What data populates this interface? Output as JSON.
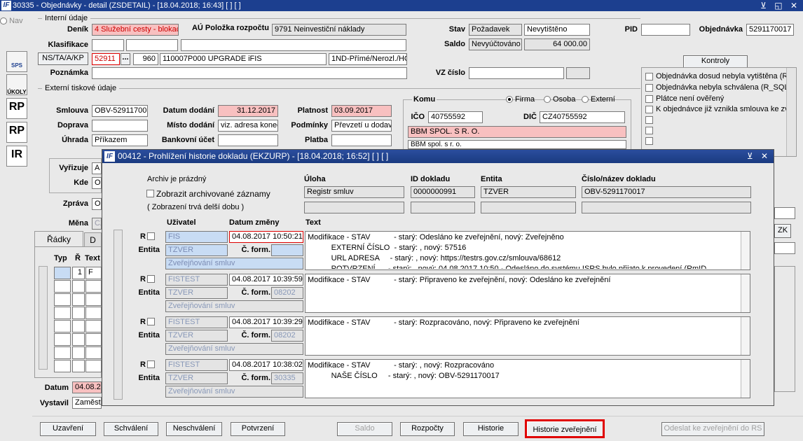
{
  "window": {
    "title": "30335 - Objednávky - detail (ZSDETAIL) - [18.04.2018; 16:43] [ ] [ ]",
    "controls": "⊻ ◱ ✕"
  },
  "side": {
    "nav": "Nav",
    "sps": "SPS",
    "ukoly": "ÚKOLY",
    "rp1": "RP",
    "rp2": "RP",
    "ir": "IR"
  },
  "interni": {
    "section": "Interní údaje",
    "denik_label": "Deník",
    "denik": "4 Služební cesty - blokac",
    "au_label": "AÚ Položka rozpočtu",
    "au": "9791 Neinvestiční náklady",
    "klasifikace_label": "Klasifikace",
    "nstakp_label": "NS/TA/A/KP",
    "ns": "52911",
    "ns_btn": "...",
    "ta": "960",
    "a": "110007P000 UPGRADE iFIS",
    "kp": "1ND-Přímé/Nerozl./HČ-",
    "poznamka_label": "Poznámka",
    "stav_label": "Stav",
    "stav1": "Požadavek",
    "stav2": "Nevytištěno",
    "saldo_label": "Saldo",
    "saldo1": "Nevyúčtováno",
    "saldo2": "64 000.00",
    "vz_label": "VZ číslo",
    "pid_label": "PID",
    "obj_label": "Objednávka",
    "obj": "5291170017"
  },
  "kontroly": {
    "button": "Kontroly",
    "items": [
      "Objednávka dosud nebyla vytištěna (R",
      "Objednávka nebyla schválena (R_SQL",
      "Plátce není ověřený",
      "K objednávce již vznikla smlouva ke zv"
    ]
  },
  "externi": {
    "section": "Externí tiskové údaje",
    "smlouva_label": "Smlouva",
    "smlouva": "OBV-52911700",
    "doprava_label": "Doprava",
    "uhrada_label": "Úhrada",
    "uhrada": "Příkazem",
    "datum_label": "Datum dodání",
    "datum": "31.12.2017",
    "misto_label": "Místo dodání",
    "misto": "viz. adresa konec",
    "bank_label": "Bankovní účet",
    "platnost_label": "Platnost",
    "platnost": "03.09.2017",
    "podminky_label": "Podmínky",
    "podminky": "Převzetí u dodav",
    "platba_label": "Platba",
    "vyrizuje_label": "Vyřizuje",
    "vyrizuje": "A",
    "kde_label": "Kde",
    "kde": "O",
    "zprava_label": "Zpráva",
    "zprava": "O",
    "mena_label": "Měna",
    "mena": "CZ"
  },
  "komu": {
    "title": "Komu",
    "firma": "Firma",
    "osoba": "Osoba",
    "externi": "Externí",
    "ico_label": "IČO",
    "ico": "40755592",
    "dic_label": "DIČ",
    "dic": "CZ40755592",
    "name": "BBM SPOL. S R. O.",
    "name2": "BBM spol. s r. o."
  },
  "radky": {
    "tab1": "Řádky",
    "tab2": "D",
    "typ": "Typ",
    "r": "Ř",
    "text": "Text",
    "row1_r": "1",
    "row1_t": "F",
    "datum_label": "Datum",
    "datum": "04.08.2",
    "vystavil_label": "Vystavil",
    "vystavil": "Zaměst",
    "zk": "ZK"
  },
  "modal": {
    "title": "00412 - Prohlížení historie dokladu (EKZURP) - [18.04.2018; 16:52] [ ] [ ]",
    "controls": "⊻ ✕",
    "archiv": "Archiv je prázdný",
    "zobrazit": "Zobrazit archivované záznamy",
    "zobrazeni": "( Zobrazení trvá delší dobu )",
    "uloha_label": "Úloha",
    "uloha": "Registr smluv",
    "id_label": "ID dokladu",
    "id": "0000000991",
    "entita_label": "Entita",
    "entita": "TZVER",
    "cislo_label": "Číslo/název dokladu",
    "cislo": "OBV-5291170017",
    "uzivatel_label": "Uživatel",
    "datumzm_label": "Datum změny",
    "text_label": "Text",
    "r_label": "R",
    "entita_row_label": "Entita",
    "cform_label": "Č. form.",
    "records": [
      {
        "user": "FIS",
        "date": "04.08.2017 10:50:21",
        "entity": "TZVER",
        "form": "",
        "desc": "Zveřejňování smluv",
        "lines": [
          "Modifikace - STAV           - starý: Odesláno ke zveřejnění, nový: Zveřejněno",
          "           EXTERNÍ ČÍSLO  - starý: , nový: 57516",
          "           URL ADRESA     - starý: , nový: https://testrs.gov.cz/smlouva/68612",
          "           POTVRZENÍ      - starý: , nový: 04.08.2017 10:50 - Odesláno do systému ISRS bylo přijato k provedení (RmID"
        ]
      },
      {
        "user": "FISTEST",
        "date": "04.08.2017 10:39:59",
        "entity": "TZVER",
        "form": "08202",
        "desc": "Zveřejňování smluv",
        "lines": [
          "Modifikace - STAV           - starý: Připraveno ke zveřejnění, nový: Odesláno ke zveřejnění"
        ]
      },
      {
        "user": "FISTEST",
        "date": "04.08.2017 10:39:29",
        "entity": "TZVER",
        "form": "08202",
        "desc": "Zveřejňování smluv",
        "lines": [
          "Modifikace - STAV           - starý: Rozpracováno, nový: Připraveno ke zveřejnění"
        ]
      },
      {
        "user": "FISTEST",
        "date": "04.08.2017 10:38:02",
        "entity": "TZVER",
        "form": "30335",
        "desc": "Zveřejňování smluv",
        "lines": [
          "Modifikace - STAV           - starý: , nový: Rozpracováno",
          "           NAŠE ČÍSLO     - starý: , nový: OBV-5291170017"
        ]
      }
    ]
  },
  "buttons": {
    "uzavreni": "Uzavření",
    "schvaleni": "Schválení",
    "neschvaleni": "Neschválení",
    "potvrzeni": "Potvrzení",
    "saldo": "Saldo",
    "rozpocty": "Rozpočty",
    "historie": "Historie",
    "historie_zver": "Historie zveřejnění",
    "odeslat": "Odeslat ke zveřejnění do RS"
  },
  "colors": {
    "title_bar": "#1c3f8f",
    "highlight_red": "#e00000",
    "pink": "#f8c0c0"
  }
}
